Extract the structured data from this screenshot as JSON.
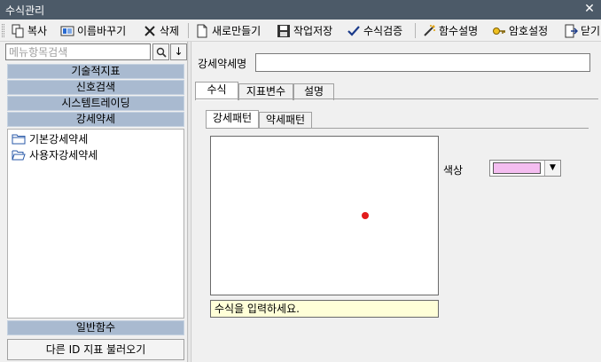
{
  "window": {
    "title": "수식관리",
    "close_glyph": "✕"
  },
  "toolbar": {
    "copy": "복사",
    "rename": "이름바꾸기",
    "delete": "삭제",
    "new": "새로만들기",
    "save_work": "작업저장",
    "verify": "수식검증",
    "func_help": "함수설명",
    "password": "암호설정",
    "close": "닫기"
  },
  "left": {
    "search_placeholder": "메뉴항목검색",
    "search_glyph": "🔍",
    "down_glyph": "↓",
    "categories": [
      "기술적지표",
      "신호검색",
      "시스템트레이딩",
      "강세약세"
    ],
    "tree": [
      {
        "label": "기본강세약세",
        "icon": "folder-closed-icon"
      },
      {
        "label": "사용자강세약세",
        "icon": "folder-open-icon"
      }
    ],
    "general_func": "일반함수",
    "load_other": "다른 ID 지표 불러오기"
  },
  "right": {
    "name_label": "강세약세명",
    "name_value": "",
    "tabs": [
      "수식",
      "지표변수",
      "설명"
    ],
    "active_tab": "수식",
    "sub_tabs": [
      "강세패턴",
      "약세패턴"
    ],
    "active_sub_tab": "강세패턴",
    "formula_placeholder": "수식을 입력하세요.",
    "color_label": "색상",
    "color_value": "#f4bdf0",
    "marker_color": "#e21b1b"
  }
}
